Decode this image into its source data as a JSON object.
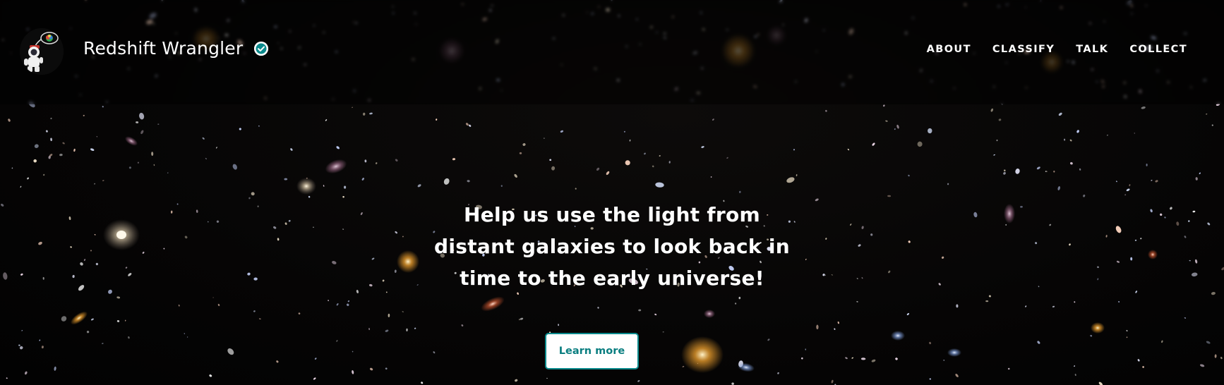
{
  "project": {
    "title": "Redshift Wrangler",
    "verified_icon": "verified-check-icon",
    "avatar_icon": "astronaut-cowboy-avatar"
  },
  "nav": {
    "items": [
      {
        "label": "ABOUT"
      },
      {
        "label": "CLASSIFY"
      },
      {
        "label": "TALK"
      },
      {
        "label": "COLLECT"
      }
    ]
  },
  "hero": {
    "headline": "Help us use the light from distant galaxies to look back in time to the early universe!",
    "cta_label": "Learn more"
  },
  "colors": {
    "accent": "#0a8a8c",
    "background": "#050505",
    "text": "#ffffff"
  }
}
